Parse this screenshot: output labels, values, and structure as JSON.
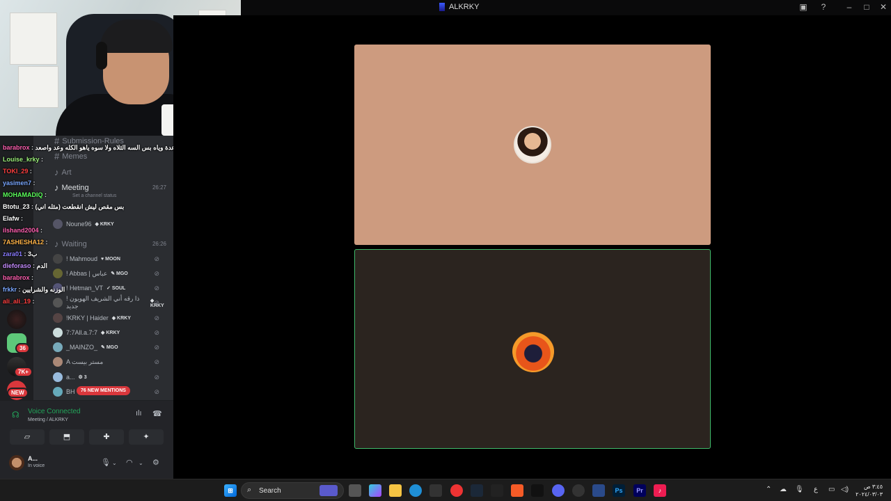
{
  "window": {
    "title": "ALKRKY"
  },
  "channels": [
    {
      "name": "Submission-Rules",
      "type": "text"
    },
    {
      "name": "Memes",
      "type": "text"
    },
    {
      "name": "Art",
      "type": "voice"
    },
    {
      "name": "Meeting",
      "type": "voice",
      "time": "26:27",
      "status": "Set a channel status"
    },
    {
      "name": "Waiting",
      "type": "voice",
      "time": "26:26"
    }
  ],
  "meeting_members": [
    {
      "name": "Noune96",
      "tag": "KRKY"
    }
  ],
  "waiting_members": [
    {
      "name": "! Mahmoud",
      "tag": "MOON"
    },
    {
      "name": "! Abbas | عباس",
      "tag": "MGO"
    },
    {
      "name": "! Hetman_VT",
      "tag": "SOUL"
    },
    {
      "name": "! ذا رقه أني الشريف الهويون جديد",
      "tag": "KRKY"
    },
    {
      "name": "!KRKY | Haider",
      "tag": "KRKY"
    },
    {
      "name": "7:7All.a.7:7",
      "tag": "KRKY"
    },
    {
      "name": "_MAINZO_",
      "tag": "MGO"
    },
    {
      "name": "A مستر بيست",
      "tag": ""
    },
    {
      "name": "a...",
      "tag": "3"
    },
    {
      "name": "BH",
      "tag": ""
    }
  ],
  "chat": [
    {
      "user": "barabrox",
      "color": "#ff5fb0",
      "msg": "اني صاعدة وياه بس السه الثلاه ولا سوه ياهو الكله وعد واصعد"
    },
    {
      "user": "Louise_krky",
      "color": "#9cf07a",
      "msg": ""
    },
    {
      "user": "TOKI_29",
      "color": "#ff4040",
      "msg": ""
    },
    {
      "user": "yasimen7",
      "color": "#7aa7ff",
      "msg": ""
    },
    {
      "user": "MOHAMADIQ",
      "color": "#5cff5c",
      "msg": ""
    },
    {
      "user": "Btotu_23",
      "color": "#ffffff",
      "msg": "بس مقص ليش انقطعت (مثله اني)"
    },
    {
      "user": "Elafw",
      "color": "#ffffff",
      "msg": ""
    },
    {
      "user": "ilshand2004",
      "color": "#ff5fb0",
      "msg": ""
    },
    {
      "user": "7ASHESHA12",
      "color": "#ffb347",
      "msg": ""
    },
    {
      "user": "zara01",
      "color": "#8a7cff",
      "msg": "ب3"
    },
    {
      "user": "dieforaso",
      "color": "#c58cff",
      "msg": "الدم"
    },
    {
      "user": "barabrox",
      "color": "#ff5fb0",
      "msg": ""
    },
    {
      "user": "frkkr",
      "color": "#7aa7ff",
      "msg": "الوزنه والشرايين"
    },
    {
      "user": "ali_ali_19",
      "color": "#ff4040",
      "msg": ""
    }
  ],
  "servers": [
    {
      "badge": "36"
    },
    {
      "badge": "7K+"
    },
    {
      "badge": "NEW"
    }
  ],
  "mentions_label": "76 NEW MENTIONS",
  "voice": {
    "status": "Voice Connected",
    "location": "Meeting / ALKRKY"
  },
  "user": {
    "name": "A...",
    "status": "In voice"
  },
  "taskbar": {
    "search_label": "Search",
    "time": "٣:٤٥ ص",
    "date": "٢٠٢٤/٠٣/٠٣",
    "lang": "ع"
  },
  "colors": {
    "tile_top": "#cd9b7f",
    "tile_bottom": "#2b241f",
    "speaking_outline": "#3fba6a",
    "voice_green": "#23a55a",
    "mention_red": "#da373c"
  }
}
